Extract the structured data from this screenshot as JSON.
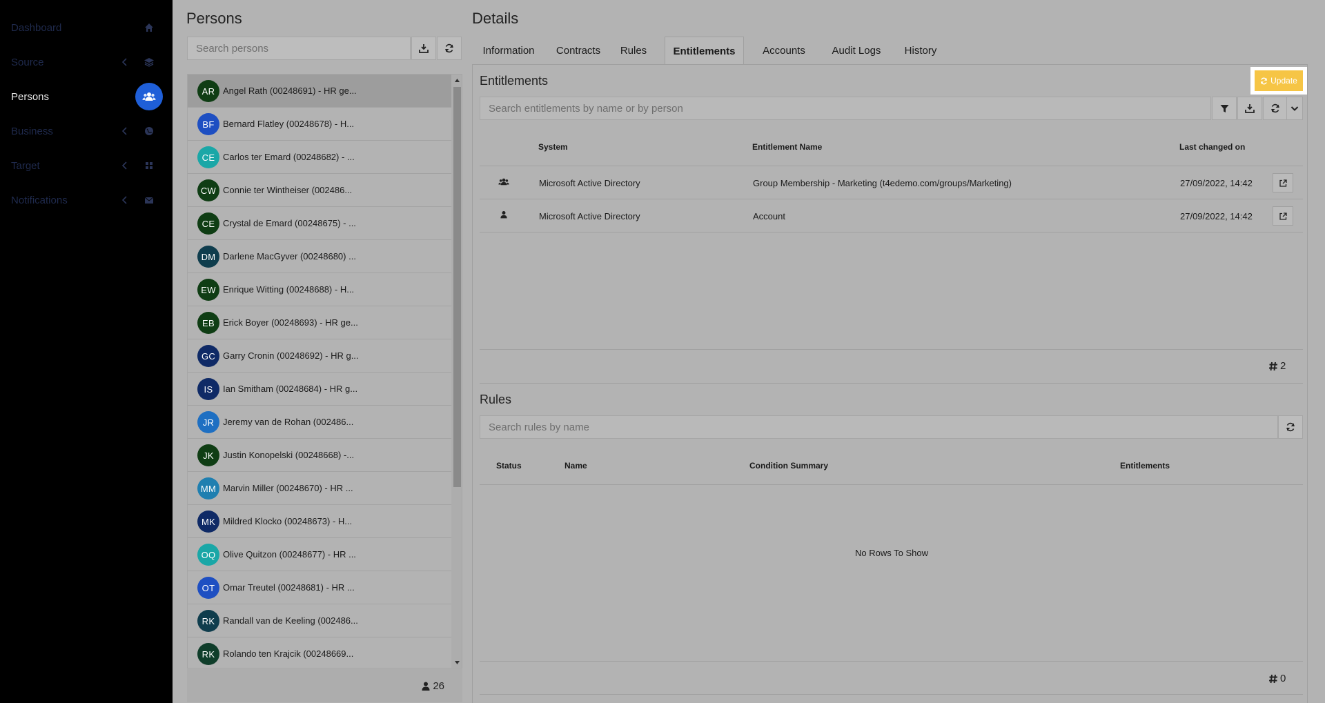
{
  "sidebar": {
    "items": [
      {
        "label": "Dashboard",
        "icon": "home-icon"
      },
      {
        "label": "Source",
        "icon": "layers-icon"
      },
      {
        "label": "Persons",
        "icon": "users-icon",
        "active": true
      },
      {
        "label": "Business",
        "icon": "globe-icon"
      },
      {
        "label": "Target",
        "icon": "grid-icon"
      },
      {
        "label": "Notifications",
        "icon": "envelope-icon"
      }
    ]
  },
  "persons": {
    "title": "Persons",
    "search_placeholder": "Search persons",
    "list": [
      {
        "initials": "AR",
        "name": "Angel Rath (00248691) - HR ge...",
        "color": "#0f3d14"
      },
      {
        "initials": "BF",
        "name": "Bernard Flatley (00248678) - H...",
        "color": "#1e4fc2"
      },
      {
        "initials": "CE",
        "name": "Carlos ter Emard (00248682) - ...",
        "color": "#1aa7a7"
      },
      {
        "initials": "CW",
        "name": "Connie ter Wintheiser (002486...",
        "color": "#0f3d14"
      },
      {
        "initials": "CE",
        "name": "Crystal de Emard (00248675) - ...",
        "color": "#0f3d14"
      },
      {
        "initials": "DM",
        "name": "Darlene MacGyver (00248680) ...",
        "color": "#0f3d4d"
      },
      {
        "initials": "EW",
        "name": "Enrique Witting (00248688) - H...",
        "color": "#0f3d14"
      },
      {
        "initials": "EB",
        "name": "Erick Boyer (00248693) - HR ge...",
        "color": "#0f3d14"
      },
      {
        "initials": "GC",
        "name": "Garry Cronin (00248692) - HR g...",
        "color": "#0f2a66"
      },
      {
        "initials": "IS",
        "name": "Ian Smitham (00248684) - HR g...",
        "color": "#0f2a66"
      },
      {
        "initials": "JR",
        "name": "Jeremy van de Rohan (002486...",
        "color": "#1e6fc2"
      },
      {
        "initials": "JK",
        "name": "Justin Konopelski (00248668) -...",
        "color": "#0f3d14"
      },
      {
        "initials": "MM",
        "name": "Marvin Miller (00248670) - HR ...",
        "color": "#1f7fb0"
      },
      {
        "initials": "MK",
        "name": "Mildred Klocko (00248673) - H...",
        "color": "#0f2a66"
      },
      {
        "initials": "OQ",
        "name": "Olive Quitzon (00248677) - HR ...",
        "color": "#1aa7a7"
      },
      {
        "initials": "OT",
        "name": "Omar Treutel (00248681) - HR ...",
        "color": "#1e4fc2"
      },
      {
        "initials": "RK",
        "name": "Randall van de Keeling (002486...",
        "color": "#0f3d4d"
      },
      {
        "initials": "RK",
        "name": "Rolando ten Krajcik (00248669...",
        "color": "#0f3d2a"
      }
    ],
    "count": "26"
  },
  "details": {
    "title": "Details",
    "tabs": [
      "Information",
      "Contracts",
      "Rules",
      "Entitlements",
      "Accounts",
      "Audit Logs",
      "History"
    ],
    "active_tab": "Entitlements",
    "entitlements": {
      "title": "Entitlements",
      "update_label": "Update",
      "search_placeholder": "Search entitlements by name or by person",
      "columns": {
        "system": "System",
        "name": "Entitlement Name",
        "changed": "Last changed on"
      },
      "rows": [
        {
          "icon": "users-icon",
          "system": "Microsoft Active Directory",
          "name": "Group Membership - Marketing (t4edemo.com/groups/Marketing)",
          "changed": "27/09/2022, 14:42"
        },
        {
          "icon": "user-icon",
          "system": "Microsoft Active Directory",
          "name": "Account",
          "changed": "27/09/2022, 14:42"
        }
      ],
      "count": "2"
    },
    "rules": {
      "title": "Rules",
      "search_placeholder": "Search rules by name",
      "columns": {
        "status": "Status",
        "name": "Name",
        "condition": "Condition Summary",
        "entitlements": "Entitlements"
      },
      "empty_text": "No Rows To Show",
      "count": "0"
    }
  }
}
